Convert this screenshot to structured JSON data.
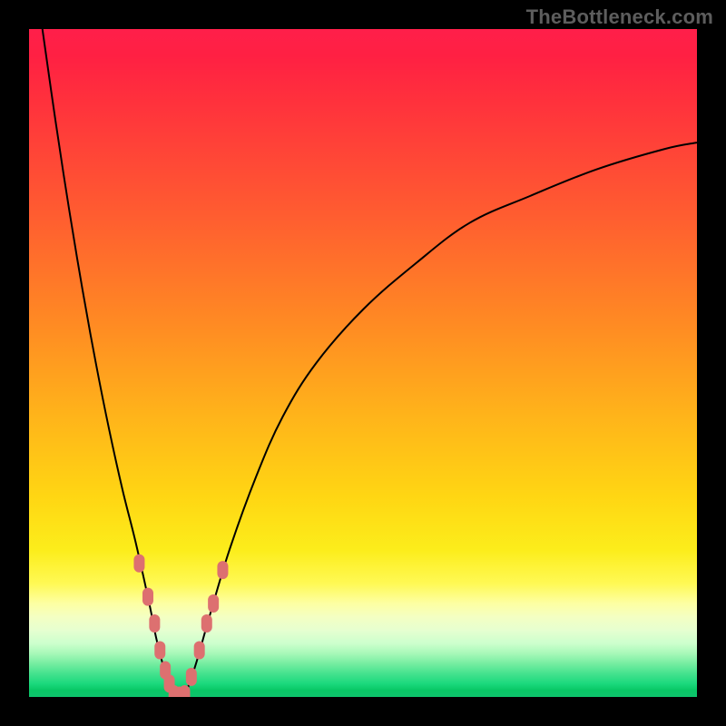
{
  "watermark": "TheBottleneck.com",
  "colors": {
    "frame": "#000000",
    "curve": "#000000",
    "marker": "#dd7070",
    "gradient_top": "#ff1f4a",
    "gradient_mid": "#ffd613",
    "gradient_bottom": "#0ec36c"
  },
  "chart_data": {
    "type": "line",
    "title": "",
    "xlabel": "",
    "ylabel": "",
    "xlim": [
      0,
      100
    ],
    "ylim": [
      0,
      100
    ],
    "axes_visible": false,
    "notes": "Bottleneck-style V curve over a vertical red→yellow→green heat gradient. No axis ticks or labels are rendered; values below are read off approximate pixel positions normalized to 0–100.",
    "series": [
      {
        "name": "left-branch",
        "x": [
          2,
          4,
          6,
          8,
          10,
          12,
          14,
          16,
          18,
          19,
          20,
          21,
          21.7
        ],
        "y": [
          100,
          86,
          73,
          61,
          50,
          40,
          31,
          23,
          14,
          9,
          5,
          2,
          0
        ]
      },
      {
        "name": "right-branch",
        "x": [
          23.3,
          25,
          27,
          30,
          34,
          38,
          43,
          50,
          58,
          66,
          75,
          85,
          95,
          100
        ],
        "y": [
          0,
          5,
          12,
          22,
          33,
          42,
          50,
          58,
          65,
          71,
          75,
          79,
          82,
          83
        ]
      }
    ],
    "markers": [
      {
        "branch": "left",
        "x": 16.5,
        "y": 20
      },
      {
        "branch": "left",
        "x": 17.8,
        "y": 15
      },
      {
        "branch": "left",
        "x": 18.8,
        "y": 11
      },
      {
        "branch": "left",
        "x": 19.6,
        "y": 7
      },
      {
        "branch": "left",
        "x": 20.4,
        "y": 4
      },
      {
        "branch": "left",
        "x": 21.0,
        "y": 2
      },
      {
        "branch": "trough",
        "x": 21.7,
        "y": 0.4
      },
      {
        "branch": "trough",
        "x": 22.5,
        "y": 0.2
      },
      {
        "branch": "trough",
        "x": 23.3,
        "y": 0.4
      },
      {
        "branch": "right",
        "x": 24.3,
        "y": 3
      },
      {
        "branch": "right",
        "x": 25.5,
        "y": 7
      },
      {
        "branch": "right",
        "x": 26.6,
        "y": 11
      },
      {
        "branch": "right",
        "x": 27.6,
        "y": 14
      },
      {
        "branch": "right",
        "x": 29.0,
        "y": 19
      }
    ]
  }
}
